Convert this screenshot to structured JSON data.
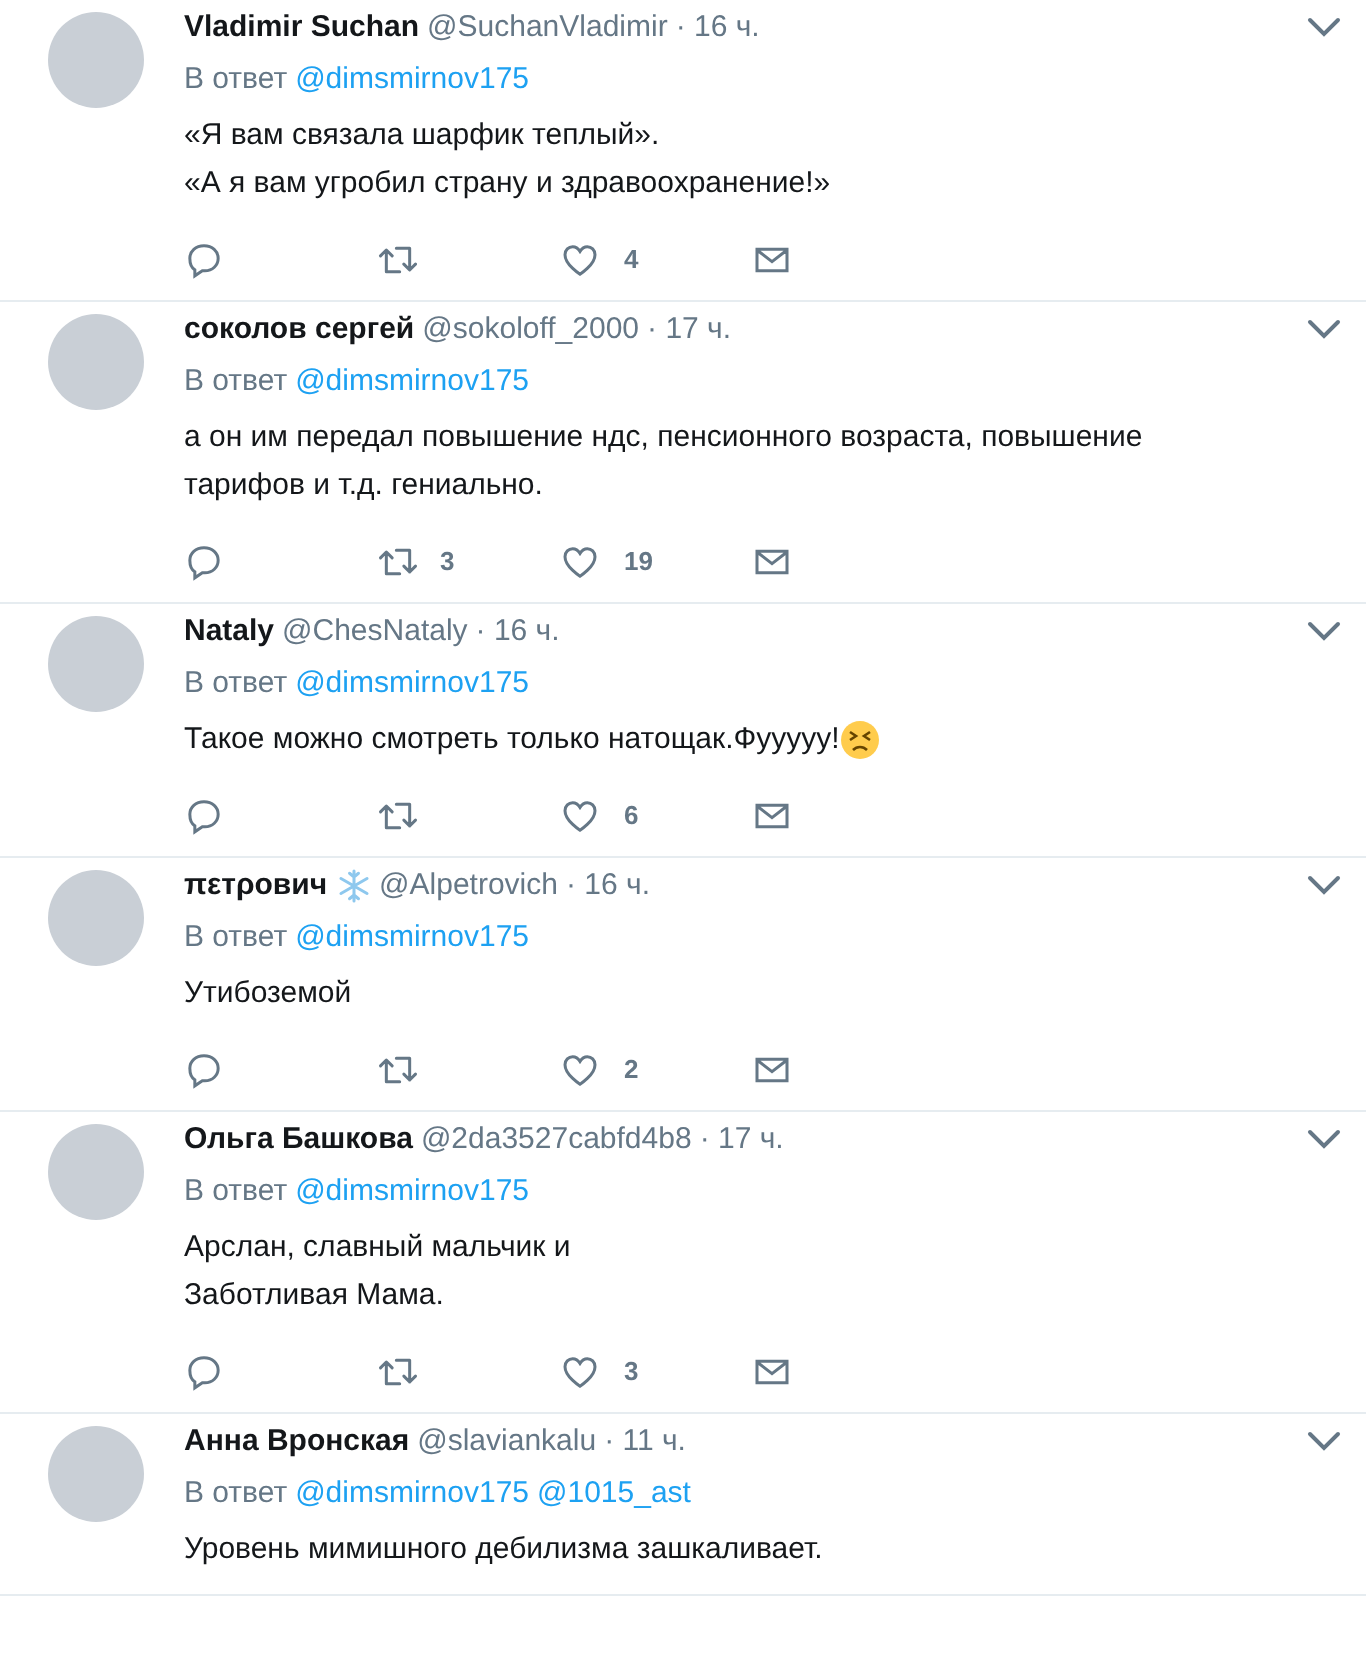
{
  "tweets": [
    {
      "name": "Vladimir Suchan",
      "handle": "@SuchanVladimir",
      "time": "· 16 ч.",
      "reply_label": "В ответ",
      "mentions": [
        "@dimsmirnov175"
      ],
      "text": [
        "«Я вам связала шарфик теплый».",
        "«А я вам угробил страну и здравоохранение!»"
      ],
      "likes": "4"
    },
    {
      "name": "соколов сергей",
      "handle": "@sokoloff_2000",
      "time": "· 17 ч.",
      "reply_label": "В ответ",
      "mentions": [
        "@dimsmirnov175"
      ],
      "text": [
        "а он им передал повышение ндс, пенсионного возраста, повышение тарифов и т.д. гениально."
      ],
      "retweets": "3",
      "likes": "19"
    },
    {
      "name": "Nataly",
      "handle": "@ChesNataly",
      "time": "· 16 ч.",
      "reply_label": "В ответ",
      "mentions": [
        "@dimsmirnov175"
      ],
      "text": [
        "Такое можно смотреть только натощак.Фууууу!"
      ],
      "text_emoji": true,
      "likes": "6"
    },
    {
      "name": "πεтρович",
      "name_badge": true,
      "handle": "@Alpetrovich",
      "time": "· 16 ч.",
      "reply_label": "В ответ",
      "mentions": [
        "@dimsmirnov175"
      ],
      "text": [
        "Утибоземой"
      ],
      "likes": "2"
    },
    {
      "name": "Ольга Башкова",
      "handle": "@2da3527cabfd4b8",
      "time": "· 17 ч.",
      "reply_label": "В ответ",
      "mentions": [
        "@dimsmirnov175"
      ],
      "text": [
        "Арслан, славный мальчик и",
        "Заботливая Мама."
      ],
      "likes": "3"
    },
    {
      "name": "Анна Вронская",
      "handle": "@slaviankalu",
      "time": "· 11 ч.",
      "reply_label": "В ответ",
      "mentions": [
        "@dimsmirnov175",
        "@1015_ast"
      ],
      "text": [
        "Уровень мимишного дебилизма зашкаливает."
      ]
    }
  ]
}
